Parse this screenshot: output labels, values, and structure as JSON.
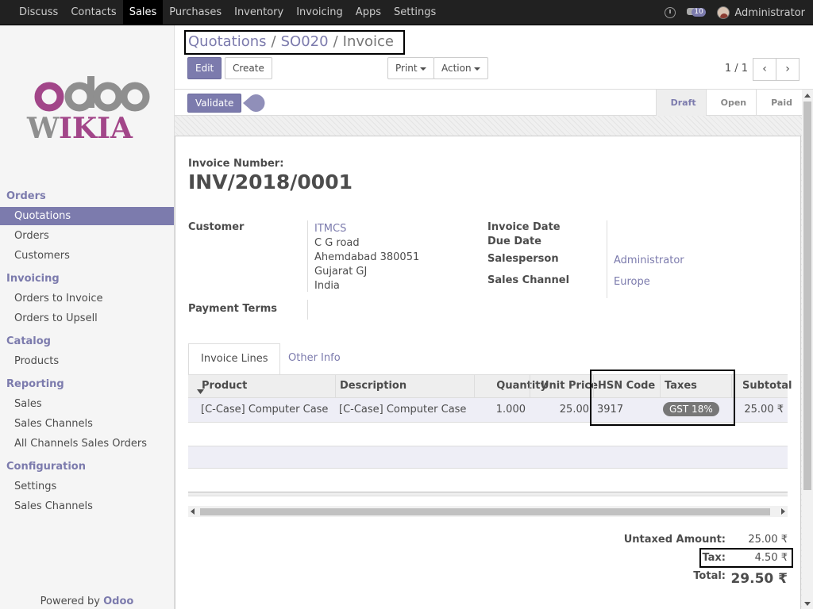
{
  "topbar": {
    "menu": [
      "Discuss",
      "Contacts",
      "Sales",
      "Purchases",
      "Inventory",
      "Invoicing",
      "Apps",
      "Settings"
    ],
    "active": "Sales",
    "chat_count": "10",
    "user": "Administrator"
  },
  "sidebar": {
    "logo_top": "odoo",
    "logo_bottom": "WIKIA",
    "sections": {
      "orders": "Orders",
      "invoicing": "Invoicing",
      "catalog": "Catalog",
      "reporting": "Reporting",
      "configuration": "Configuration"
    },
    "items": {
      "quotations": "Quotations",
      "orders": "Orders",
      "customers": "Customers",
      "orders_to_invoice": "Orders to Invoice",
      "orders_to_upsell": "Orders to Upsell",
      "products": "Products",
      "sales": "Sales",
      "sales_channels": "Sales Channels",
      "all_channels": "All Channels Sales Orders",
      "settings": "Settings",
      "config_sales_channels": "Sales Channels"
    },
    "powered_by": "Powered by",
    "powered_brand": "Odoo"
  },
  "breadcrumb": {
    "crumb1": "Quotations",
    "crumb2": "SO020",
    "current": "Invoice",
    "sep": "/"
  },
  "buttons": {
    "edit": "Edit",
    "create": "Create",
    "print": "Print",
    "action": "Action",
    "validate": "Validate"
  },
  "pager": {
    "value": "1 / 1",
    "prev": "‹",
    "next": "›"
  },
  "stages": [
    "Draft",
    "Open",
    "Paid"
  ],
  "current_stage": "Draft",
  "invoice": {
    "number_label": "Invoice Number:",
    "number": "INV/2018/0001",
    "customer_label": "Customer",
    "customer_name": "ITMCS",
    "address": [
      "C G road",
      "Ahemdabad 380051",
      "Gujarat GJ",
      "India"
    ],
    "payment_terms_label": "Payment Terms",
    "invoice_date_label": "Invoice Date",
    "due_date_label": "Due Date",
    "salesperson_label": "Salesperson",
    "salesperson": "Administrator",
    "sales_channel_label": "Sales Channel",
    "sales_channel": "Europe"
  },
  "tabs": {
    "lines": "Invoice Lines",
    "other": "Other Info"
  },
  "table": {
    "headers": {
      "product": "Product",
      "description": "Description",
      "quantity": "Quantity",
      "unit_price": "Unit Price",
      "hsn": "HSN Code",
      "taxes": "Taxes",
      "subtotal": "Subtotal"
    },
    "row": {
      "product": "[C-Case] Computer Case",
      "description": "[C-Case] Computer Case",
      "quantity": "1.000",
      "unit_price": "25.00",
      "hsn": "3917",
      "taxes": "GST 18%",
      "subtotal": "25.00 ₹"
    }
  },
  "totals": {
    "untaxed_label": "Untaxed Amount:",
    "untaxed": "25.00 ₹",
    "tax_label": "Tax:",
    "tax": "4.50 ₹",
    "total_label": "Total:",
    "total": "29.50 ₹"
  },
  "colors": {
    "accent": "#7c7bad",
    "navbar": "#212121",
    "sidebar": "#f5f5f5"
  }
}
